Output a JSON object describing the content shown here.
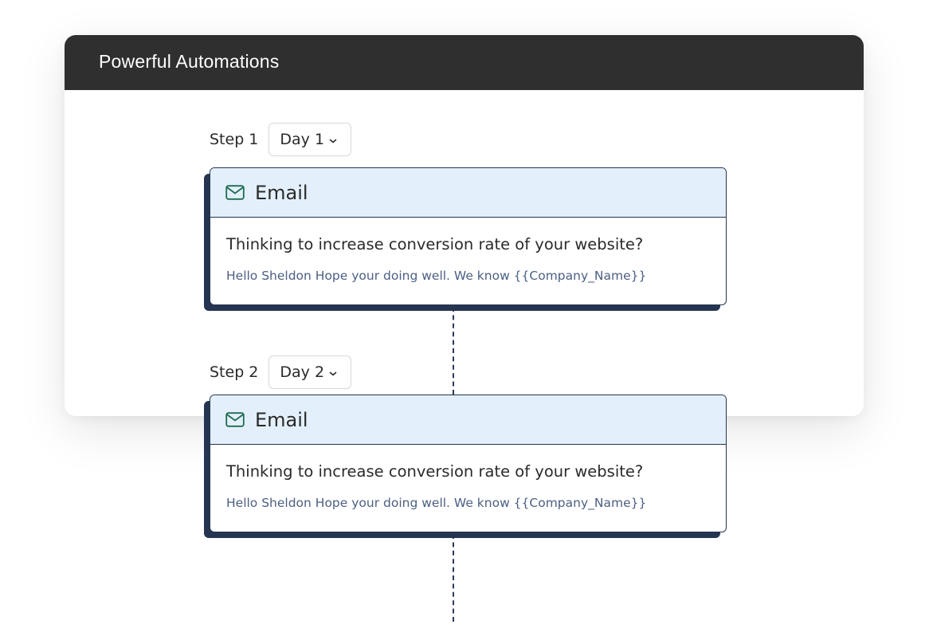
{
  "panel": {
    "title": "Powerful Automations"
  },
  "steps": [
    {
      "label": "Step 1",
      "day": "Day 1",
      "card": {
        "type": "Email",
        "icon": "mail-icon",
        "subject": "Thinking to increase conversion rate of your website?",
        "preview": "Hello Sheldon Hope your doing well. We know {{Company_Name}}"
      }
    },
    {
      "label": "Step 2",
      "day": "Day 2",
      "card": {
        "type": "Email",
        "icon": "mail-icon",
        "subject": "Thinking to increase conversion rate of your website?",
        "preview": "Hello Sheldon Hope your doing well. We know {{Company_Name}}"
      }
    }
  ],
  "colors": {
    "header_bg": "#2f2f2f",
    "card_border": "#253450",
    "card_head_bg": "#e3f0fc",
    "icon_color": "#1f6b4f",
    "preview_text": "#4c5f82"
  }
}
